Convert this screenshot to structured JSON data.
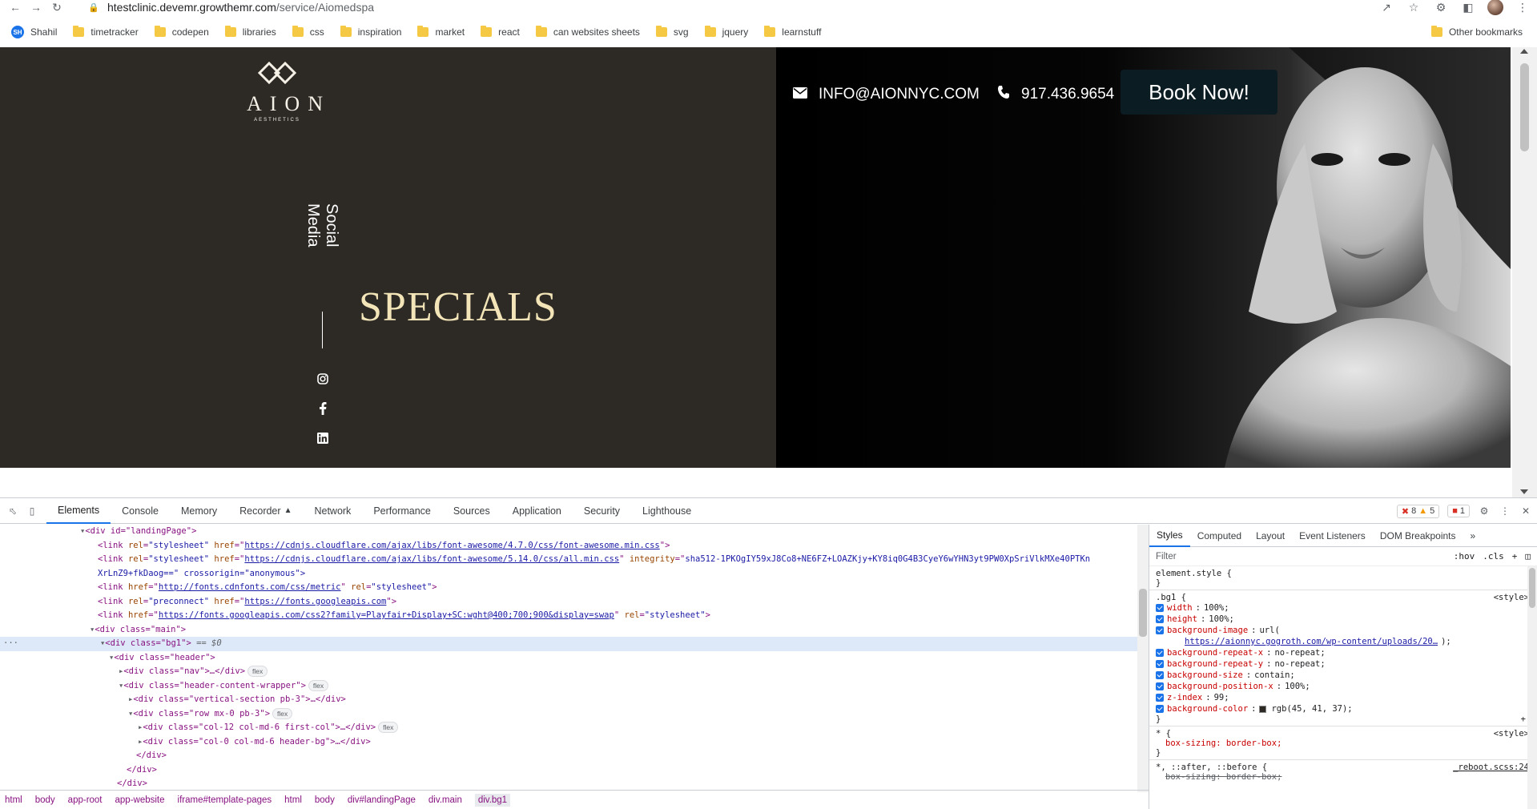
{
  "browser": {
    "url_host": "htestclinic.devemr.growthemr.com",
    "url_path": "/service/Aiomedspa",
    "bookmarks": [
      {
        "label": "Shahil",
        "kind": "profile",
        "badge": "SH"
      },
      {
        "label": "timetracker",
        "kind": "folder"
      },
      {
        "label": "codepen",
        "kind": "folder"
      },
      {
        "label": "libraries",
        "kind": "folder"
      },
      {
        "label": "css",
        "kind": "folder"
      },
      {
        "label": "inspiration",
        "kind": "folder"
      },
      {
        "label": "market",
        "kind": "folder"
      },
      {
        "label": "react",
        "kind": "folder"
      },
      {
        "label": "can websites sheets",
        "kind": "folder"
      },
      {
        "label": "svg",
        "kind": "folder"
      },
      {
        "label": "jquery",
        "kind": "folder"
      },
      {
        "label": "learnstuff",
        "kind": "folder"
      }
    ],
    "other_bookmarks": "Other bookmarks"
  },
  "page": {
    "logo_brand": "AION",
    "logo_sub": "AESTHETICS",
    "social_label": "Social Media",
    "specials": "SPECIALS",
    "email": "INFO@AIONNYC.COM",
    "phone": "917.436.9654",
    "book_label": "Book Now!"
  },
  "devtools": {
    "tabs": [
      "Elements",
      "Console",
      "Memory",
      "Recorder",
      "Network",
      "Performance",
      "Sources",
      "Application",
      "Security",
      "Lighthouse"
    ],
    "active_tab": "Elements",
    "errors": "8",
    "warnings": "5",
    "issues": "1",
    "breadcrumbs": [
      "html",
      "body",
      "app-root",
      "app-website",
      "iframe#template-pages",
      "html",
      "body",
      "div#landingPage",
      "div.main",
      "div.bg1"
    ],
    "styles_tabs": [
      "Styles",
      "Computed",
      "Layout",
      "Event Listeners",
      "DOM Breakpoints"
    ],
    "filter_placeholder": "Filter",
    "hov": ":hov",
    "cls": ".cls",
    "dom": {
      "l0": "<div id=\"landingPage\">",
      "l1_href": "https://cdnjs.cloudflare.com/ajax/libs/font-awesome/4.7.0/css/font-awesome.min.css",
      "l2_href": "https://cdnjs.cloudflare.com/ajax/libs/font-awesome/5.14.0/css/all.min.css",
      "l2_integrity": "sha512-1PKOgIY59xJ8Co8+NE6FZ+LOAZKjy+KY8iq0G4B3CyeY6wYHN3yt9PW0XpSriVlkMXe40PTKn",
      "l2b": "XrLnZ9+fkDaog==\" crossorigin=\"anonymous\">",
      "l3_href": "http://fonts.cdnfonts.com/css/metric",
      "l4_href": "https://fonts.googleapis.com",
      "l5_href": "https://fonts.googleapis.com/css2?family=Playfair+Display+SC:wght@400;700;900&display=swap",
      "l6": "<div class=\"main\">",
      "l7": "<div class=\"bg1\">",
      "l7_eq": "== $0",
      "l8": "<div class=\"header\">",
      "l9": "<div class=\"nav\">…</div>",
      "l10": "<div class=\"header-content-wrapper\">",
      "l11": "<div class=\"vertical-section pb-3\">…</div>",
      "l12": "<div class=\"row mx-0 pb-3\">",
      "l13": "<div class=\"col-12 col-md-6 first-col\">…</div>",
      "l14": "<div class=\"col-0 col-md-6 header-bg\">…</div>",
      "l15": "</div>",
      "l16": "</div>",
      "l17": "</div>",
      "flex": "flex"
    },
    "styles": {
      "element_style": "element.style {",
      "bg1_selector": ".bg1 {",
      "src_style": "<style>",
      "props": [
        {
          "name": "width",
          "value": "100%;"
        },
        {
          "name": "height",
          "value": "100%;"
        },
        {
          "name": "background-image",
          "value": "url("
        },
        {
          "name": "background-repeat-x",
          "value": "no-repeat;"
        },
        {
          "name": "background-repeat-y",
          "value": "no-repeat;"
        },
        {
          "name": "background-size",
          "value": "contain;"
        },
        {
          "name": "background-position-x",
          "value": "100%;"
        },
        {
          "name": "z-index",
          "value": "99;"
        },
        {
          "name": "background-color",
          "value": "rgb(45, 41, 37);"
        }
      ],
      "bg_url": "https://aionnyc.gogroth.com/wp-content/uploads/20…",
      "bg_url_end": ");",
      "star_selector": "* {",
      "box_sizing": "box-sizing: border-box;",
      "after_selector": "*, ::after, ::before {",
      "reboot_src": "_reboot.scss:24",
      "box_sizing_struck": "box-sizing: border-box;"
    }
  }
}
